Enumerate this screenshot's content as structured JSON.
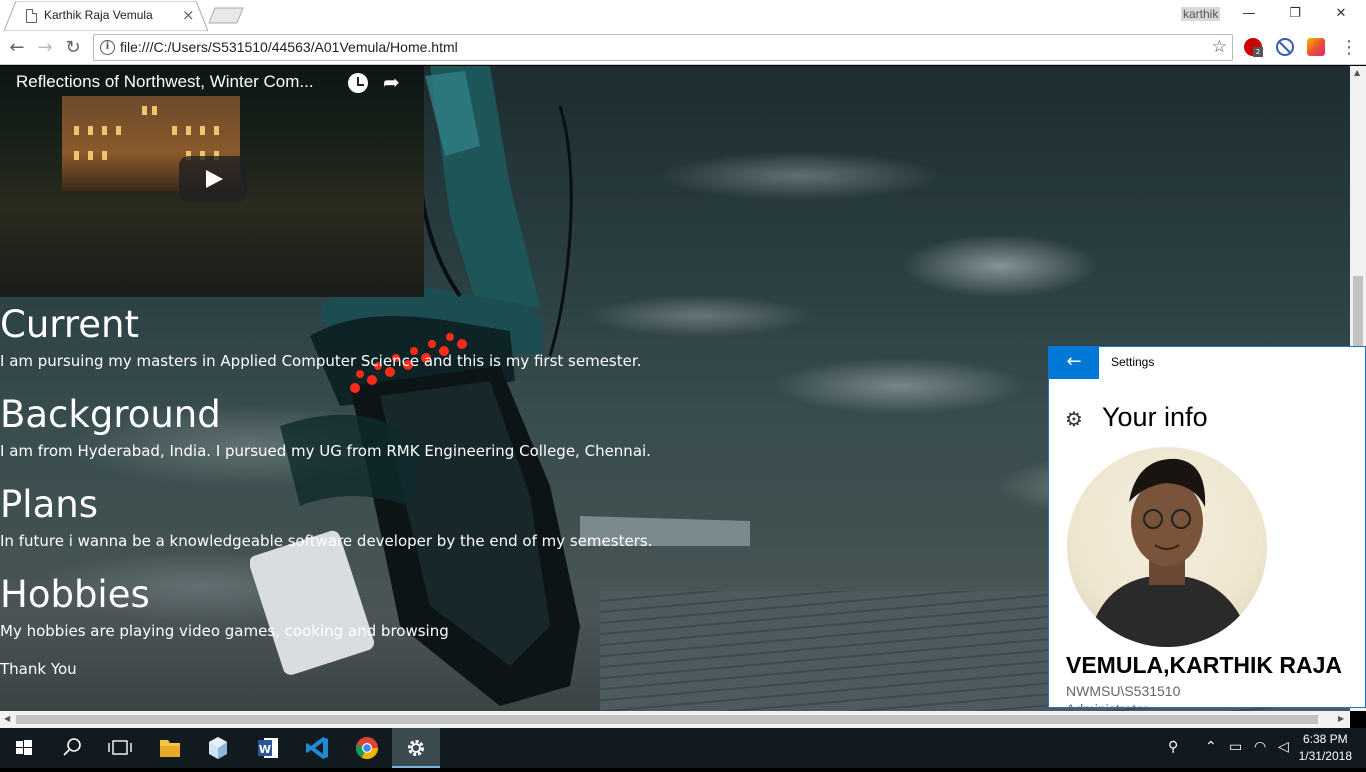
{
  "browser": {
    "tab_title": "Karthik Raja Vemula",
    "tab_close": "×",
    "profile_name": "karthik",
    "url": "file:///C:/Users/S531510/44563/A01Vemula/Home.html",
    "window_controls": {
      "minimize": "—",
      "restore": "❐",
      "close": "✕"
    }
  },
  "video": {
    "title": "Reflections of Northwest, Winter Com..."
  },
  "sections": [
    {
      "heading": "Current",
      "text": "I am pursuing my masters in Applied Computer Science and this is my first semester."
    },
    {
      "heading": "Background",
      "text": "I am from Hyderabad, India. I pursued my UG from RMK Engineering College, Chennai."
    },
    {
      "heading": "Plans",
      "text": "In future i wanna be a knowledgeable software developer by the end of my semesters."
    },
    {
      "heading": "Hobbies",
      "text": "My hobbies are playing video games, cooking and browsing"
    }
  ],
  "closing": "Thank You",
  "settings": {
    "title": "Settings",
    "page_title": "Your info",
    "user_name": "VEMULA,KARTHIK RAJA",
    "domain": "NWMSU\\S531510",
    "role": "Administrator"
  },
  "taskbar": {
    "time": "6:38 PM",
    "date": "1/31/2018"
  },
  "colors": {
    "accent": "#0078d7",
    "taskbar": "#101a1f"
  }
}
